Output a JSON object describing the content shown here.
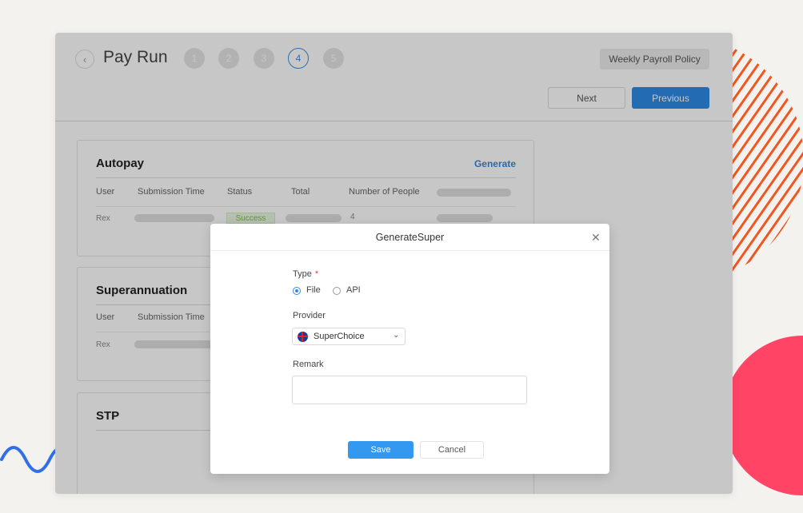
{
  "header": {
    "title": "Pay Run",
    "back_icon": "chevron-left-icon",
    "steps": [
      "1",
      "2",
      "3",
      "4",
      "5"
    ],
    "active_step": "4",
    "policy_label": "Weekly Payroll Policy",
    "next_label": "Next",
    "previous_label": "Previous"
  },
  "autopay": {
    "title": "Autopay",
    "action": "Generate",
    "columns": [
      "User",
      "Submission Time",
      "Status",
      "Total",
      "Number of People"
    ],
    "rows": [
      {
        "user": "Rex",
        "status": "Success",
        "number_of_people": "4"
      }
    ]
  },
  "superannuation": {
    "title": "Superannuation",
    "columns": [
      "User",
      "Submission Time"
    ],
    "rows": [
      {
        "user": "Rex"
      }
    ]
  },
  "stp": {
    "title": "STP"
  },
  "modal": {
    "title": "GenerateSuper",
    "close_icon": "close-icon",
    "type_label": "Type",
    "required_mark": "*",
    "type_options": [
      "File",
      "API"
    ],
    "type_selected": "File",
    "provider_label": "Provider",
    "provider_value": "SuperChoice",
    "provider_icon": "australia-flag-icon",
    "remark_label": "Remark",
    "remark_value": "",
    "save_label": "Save",
    "cancel_label": "Cancel"
  },
  "colors": {
    "primary": "#2e8ae6",
    "success_text": "#7dbf4c",
    "decor_orange": "#f0561f",
    "decor_red": "#ff4466",
    "decor_blue": "#2f6fe8"
  }
}
